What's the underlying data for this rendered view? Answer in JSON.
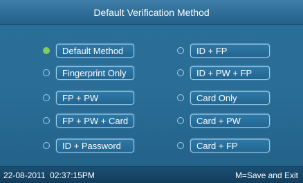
{
  "header": {
    "title": "Default Verification Method"
  },
  "options": [
    {
      "label": "Default Method",
      "selected": true
    },
    {
      "label": "ID + FP",
      "selected": false
    },
    {
      "label": "Fingerprint Only",
      "selected": false
    },
    {
      "label": "ID + PW + FP",
      "selected": false
    },
    {
      "label": "FP + PW",
      "selected": false
    },
    {
      "label": "Card Only",
      "selected": false
    },
    {
      "label": "FP + PW + Card",
      "selected": false
    },
    {
      "label": "Card + PW",
      "selected": false
    },
    {
      "label": "ID + Password",
      "selected": false
    },
    {
      "label": "Card + FP",
      "selected": false
    }
  ],
  "status": {
    "datetime": "22-08-2011  02:37:15PM",
    "hint": "M=Save and Exit"
  },
  "colors": {
    "background": "#2a6e97",
    "selected_radio": "#7fcf5a",
    "unselected_radio": "#a8cfea",
    "pill_border": "#9fd0f0",
    "status_bar": "#123e5e"
  }
}
